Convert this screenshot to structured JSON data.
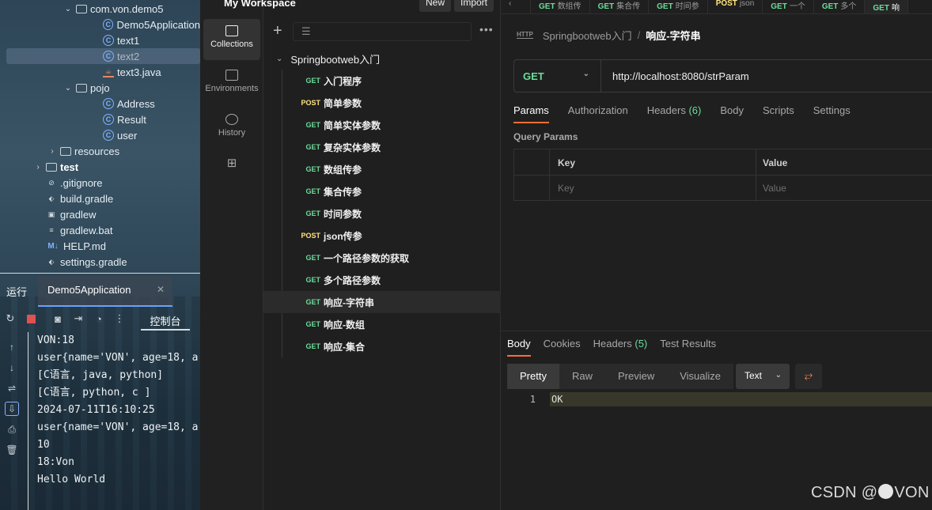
{
  "ide": {
    "tree": [
      {
        "label": "com.von.demo5",
        "type": "folder",
        "indent": 96,
        "chev": "⌄"
      },
      {
        "label": "Demo5Application",
        "type": "cls",
        "indent": 130
      },
      {
        "label": "text1",
        "type": "cls",
        "indent": 130
      },
      {
        "label": "text2",
        "type": "cls",
        "indent": 130,
        "selected": true
      },
      {
        "label": "text3.java",
        "type": "java",
        "indent": 130
      },
      {
        "label": "pojo",
        "type": "folder",
        "indent": 96,
        "chev": "⌄"
      },
      {
        "label": "Address",
        "type": "cls",
        "indent": 130
      },
      {
        "label": "Result",
        "type": "cls",
        "indent": 130
      },
      {
        "label": "user",
        "type": "cls",
        "indent": 130
      },
      {
        "label": "resources",
        "type": "folder",
        "indent": 76,
        "chev": "›"
      },
      {
        "label": "test",
        "type": "folder",
        "indent": 58,
        "chev": "›",
        "bold": true
      },
      {
        "label": ".gitignore",
        "type": "file",
        "indent": 58,
        "glyph": "⊘"
      },
      {
        "label": "build.gradle",
        "type": "file",
        "indent": 58,
        "glyph": "⬖"
      },
      {
        "label": "gradlew",
        "type": "file",
        "indent": 58,
        "glyph": "▣"
      },
      {
        "label": "gradlew.bat",
        "type": "file",
        "indent": 58,
        "glyph": "≡"
      },
      {
        "label": "HELP.md",
        "type": "md",
        "indent": 58,
        "glyph": "M↓"
      },
      {
        "label": "settings.gradle",
        "type": "file",
        "indent": 58,
        "glyph": "⬖"
      }
    ],
    "run_label": "运行",
    "run_tab": "Demo5Application",
    "console_tab": "控制台",
    "console_lines": [
      "VON:18",
      "user{name='VON', age=18, a",
      "[C语言, java, python]",
      "[C语言, python, c  ]",
      "2024-07-11T16:10:25",
      "user{name='VON', age=18, a",
      "10",
      "18:Von",
      "Hello World"
    ]
  },
  "postman": {
    "workspace": "My Workspace",
    "new_label": "New",
    "import_label": "Import",
    "nav": [
      {
        "label": "Collections",
        "icon": "collections-icon",
        "active": true
      },
      {
        "label": "Environments",
        "icon": "environments-icon"
      },
      {
        "label": "History",
        "icon": "history-icon"
      },
      {
        "label": "",
        "icon": "add-workspace-icon"
      }
    ],
    "collection": "Springbootweb入门",
    "requests": [
      {
        "method": "GET",
        "name": "入门程序"
      },
      {
        "method": "POST",
        "name": "简单参数"
      },
      {
        "method": "GET",
        "name": "简单实体参数"
      },
      {
        "method": "GET",
        "name": "复杂实体参数"
      },
      {
        "method": "GET",
        "name": "数组传参"
      },
      {
        "method": "GET",
        "name": "集合传参"
      },
      {
        "method": "GET",
        "name": "时间参数"
      },
      {
        "method": "POST",
        "name": "json传参"
      },
      {
        "method": "GET",
        "name": "一个路径参数的获取"
      },
      {
        "method": "GET",
        "name": "多个路径参数"
      },
      {
        "method": "GET",
        "name": "响应-字符串",
        "active": true
      },
      {
        "method": "GET",
        "name": "响应-数组"
      },
      {
        "method": "GET",
        "name": "响应-集合"
      }
    ],
    "open_tabs": [
      {
        "method": "GET",
        "name": "数组传"
      },
      {
        "method": "GET",
        "name": "集合传"
      },
      {
        "method": "GET",
        "name": "时间参"
      },
      {
        "method": "POST",
        "name": "json"
      },
      {
        "method": "GET",
        "name": "一个"
      },
      {
        "method": "GET",
        "name": "多个"
      },
      {
        "method": "GET",
        "name": "响",
        "active": true
      }
    ],
    "breadcrumb": {
      "parent": "Springbootweb入门",
      "current": "响应-字符串",
      "http": "HTTP"
    },
    "method": "GET",
    "url": "http://localhost:8080/strParam",
    "req_tabs": [
      {
        "label": "Params",
        "active": true,
        "count": ""
      },
      {
        "label": "Authorization",
        "count": ""
      },
      {
        "label": "Headers",
        "count": "(6)"
      },
      {
        "label": "Body",
        "count": ""
      },
      {
        "label": "Scripts",
        "count": ""
      },
      {
        "label": "Settings",
        "count": ""
      }
    ],
    "query_params_label": "Query Params",
    "col_key": "Key",
    "col_value": "Value",
    "key_placeholder": "Key",
    "value_placeholder": "Value",
    "resp_tabs": [
      {
        "label": "Body",
        "active": true,
        "count": ""
      },
      {
        "label": "Cookies",
        "count": ""
      },
      {
        "label": "Headers",
        "count": "(5)"
      },
      {
        "label": "Test Results",
        "count": ""
      }
    ],
    "formats": [
      {
        "label": "Pretty",
        "active": true
      },
      {
        "label": "Raw"
      },
      {
        "label": "Preview"
      },
      {
        "label": "Visualize"
      }
    ],
    "format_type": "Text",
    "response_line_no": "1",
    "response_text": "OK"
  },
  "watermark": {
    "pre": "CSDN @",
    "post": "VON"
  },
  "colors": {
    "accent": "#ff6c37",
    "get": "#6bdd9a",
    "post": "#ffe47e"
  }
}
